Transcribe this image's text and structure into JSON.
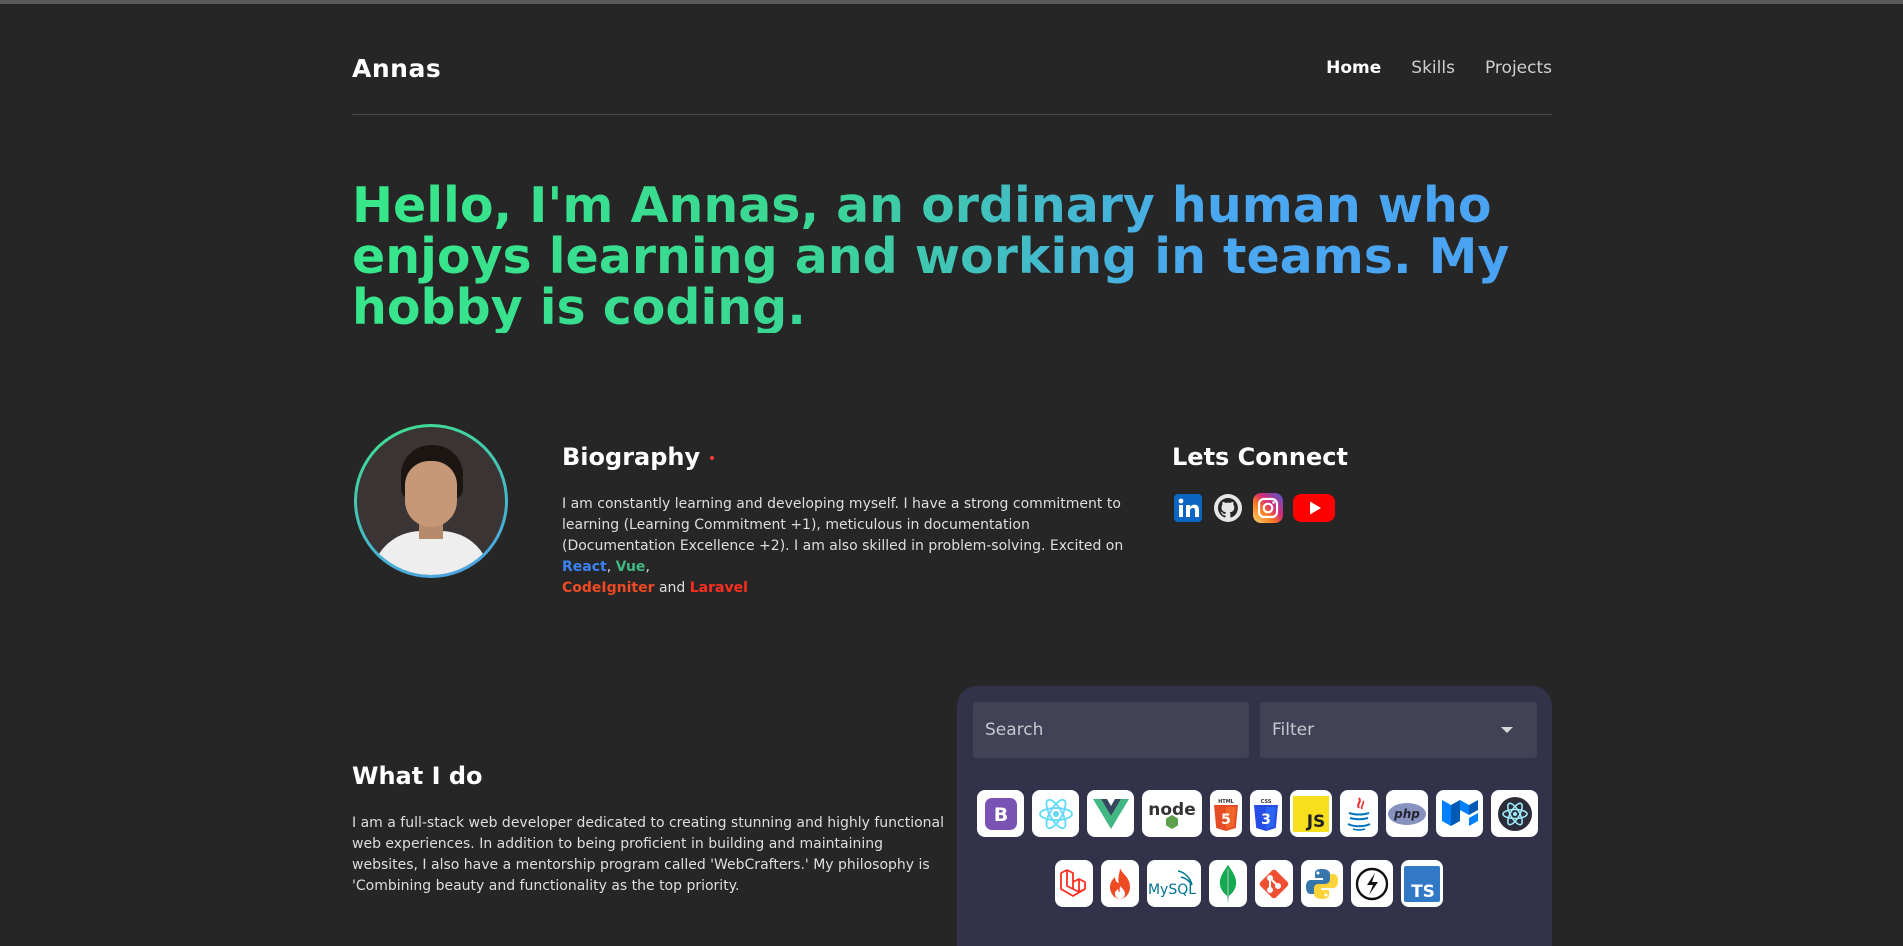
{
  "nav": {
    "brand": "Annas",
    "links": [
      {
        "label": "Home",
        "active": true
      },
      {
        "label": "Skills",
        "active": false
      },
      {
        "label": "Projects",
        "active": false
      }
    ]
  },
  "hero": {
    "text": "Hello, I'm Annas, an ordinary human who enjoys learning and working in teams. My hobby is coding."
  },
  "bio": {
    "title": "Biography",
    "text_intro": "I am constantly learning and developing myself. I have a strong commitment to learning (Learning Commitment +1), meticulous in documentation (Documentation Excellence +2). I am also skilled in problem-solving. Excited on ",
    "react": "React",
    "sep1": ", ",
    "vue": "Vue",
    "sep2": ",",
    "codeigniter": "CodeIgniter",
    "and": " and ",
    "laravel": "Laravel"
  },
  "connect": {
    "title": "Lets Connect",
    "icons": [
      "linkedin-icon",
      "github-icon",
      "instagram-icon",
      "youtube-icon"
    ]
  },
  "what_i_do": {
    "title": "What I do",
    "text": "I am a full-stack web developer dedicated to creating stunning and highly functional web experiences. In addition to being proficient in building and maintaining websites, I also have a mentorship program called 'WebCrafters.' My philosophy is 'Combining beauty and functionality as the top priority."
  },
  "skills_panel": {
    "search_placeholder": "Search",
    "filter_label": "Filter",
    "icon_labels": {
      "bootstrap": "B",
      "node": "node",
      "html": "HTML",
      "css": "CSS",
      "js": "JS",
      "php": "php",
      "mysql": "MySQL",
      "ts": "TS"
    },
    "row1": [
      "bootstrap-icon",
      "react-icon",
      "vue-icon",
      "nodejs-icon",
      "html5-icon",
      "css3-icon",
      "javascript-icon",
      "java-icon",
      "php-icon",
      "mui-icon",
      "electron-icon"
    ],
    "row2": [
      "laravel-icon",
      "codeigniter-icon",
      "mysql-icon",
      "mongodb-icon",
      "git-icon",
      "python-icon",
      "express-icon",
      "typescript-icon"
    ]
  },
  "colors": {
    "background": "#262626",
    "panel": "#32324a",
    "gradient_start": "#37e88a",
    "gradient_end": "#4aa2f2",
    "react": "#3b82f6",
    "vue": "#41b883",
    "codeigniter": "#ef4a23",
    "laravel": "#ff2d20"
  }
}
